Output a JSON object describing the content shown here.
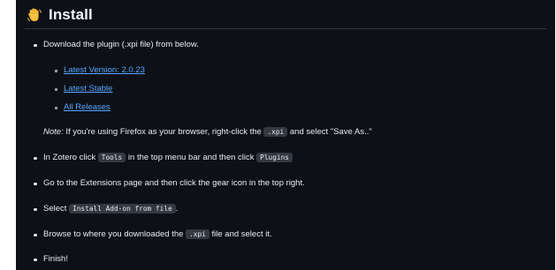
{
  "section": {
    "title": "Install",
    "icon": "waving-hand-icon"
  },
  "steps": {
    "download": "Download the plugin (.xpi file) from below.",
    "links": {
      "latest_version": "Latest Version: 2.0.23",
      "latest_stable": "Latest Stable",
      "all_releases": "All Releases"
    },
    "note": {
      "label": "Note:",
      "text_before": "If you're using Firefox as your browser, right-click the",
      "code": ".xpi",
      "text_after": "and select \"Save As..\""
    },
    "zotero": {
      "text_1": "In Zotero click",
      "code_1": "Tools",
      "text_2": "in the top menu bar and then click",
      "code_2": "Plugins"
    },
    "extensions": "Go to the Extensions page and then click the gear icon in the top right.",
    "select": {
      "text": "Select",
      "code": "Install Add-on from file",
      "end": "."
    },
    "browse": {
      "text_1": "Browse to where you downloaded the",
      "code": ".xpi",
      "text_2": "file and select it."
    },
    "finish": "Finish!"
  },
  "colors": {
    "background": "#0d1117",
    "text": "#e6edf3",
    "link": "#58a6ff",
    "code_background": "#343941"
  }
}
